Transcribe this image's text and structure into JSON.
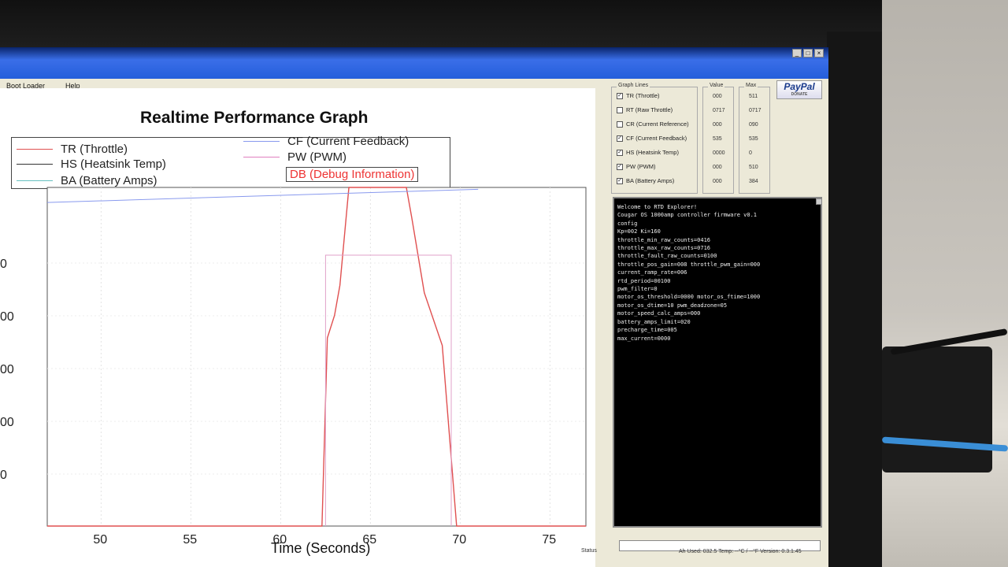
{
  "window": {
    "menu": [
      "Boot Loader",
      "Help"
    ],
    "controls": [
      "_",
      "□",
      "×"
    ]
  },
  "graph": {
    "title": "Realtime Performance Graph",
    "legend": [
      {
        "label": "TR (Throttle)",
        "color": "#e05050"
      },
      {
        "label": "HS (Heatsink Temp)",
        "color": "#333333"
      },
      {
        "label": "BA (Battery Amps)",
        "color": "#66c0c0"
      },
      {
        "label": "CF (Current Feedback)",
        "color": "#8899ee"
      },
      {
        "label": "PW (PWM)",
        "color": "#e080c0"
      },
      {
        "label": "DB (Debug Information)",
        "color": "#e05050",
        "highlighted": true
      }
    ],
    "xlabel": "Time (Seconds)",
    "x_ticks": [
      "50",
      "55",
      "60",
      "65",
      "70",
      "75"
    ],
    "y_ticks": [
      "0",
      "00",
      "00",
      "00",
      "0"
    ]
  },
  "chart_data": {
    "type": "line",
    "title": "Realtime Performance Graph",
    "xlabel": "Time (Seconds)",
    "ylabel": "",
    "xlim": [
      47,
      77
    ],
    "ylim": [
      0,
      900
    ],
    "series": [
      {
        "name": "TR (Throttle)",
        "x": [
          47,
          62.3,
          62.6,
          63,
          63.3,
          63.8,
          64,
          67,
          67.3,
          68,
          69,
          69.8,
          77
        ],
        "y": [
          0,
          0,
          500,
          560,
          640,
          900,
          900,
          900,
          820,
          620,
          480,
          0,
          0
        ]
      },
      {
        "name": "CF (Current Feedback)",
        "x": [
          47,
          71
        ],
        "y": [
          860,
          895
        ]
      },
      {
        "name": "PW (PWM)",
        "x": [
          62.5,
          62.5,
          69.5,
          69.5
        ],
        "y": [
          0,
          720,
          720,
          0
        ]
      }
    ]
  },
  "graph_lines": {
    "label": "Graph Lines",
    "value_header": "Value",
    "max_header": "Max",
    "items": [
      {
        "label": "TR (Throttle)",
        "checked": true,
        "value": "000",
        "max": "511"
      },
      {
        "label": "RT (Raw Throttle)",
        "checked": false,
        "value": "0717",
        "max": "0717"
      },
      {
        "label": "CR (Current Reference)",
        "checked": false,
        "value": "000",
        "max": "090"
      },
      {
        "label": "CF (Current Feedback)",
        "checked": true,
        "value": "535",
        "max": "535"
      },
      {
        "label": "HS (Heatsink Temp)",
        "checked": true,
        "value": "0000",
        "max": "0"
      },
      {
        "label": "PW (PWM)",
        "checked": true,
        "value": "000",
        "max": "510"
      },
      {
        "label": "BA (Battery Amps)",
        "checked": true,
        "value": "000",
        "max": "384"
      }
    ]
  },
  "paypal": {
    "brand": "PayPal",
    "sub": "DONATE"
  },
  "console": {
    "lines": [
      "Welcome to RTD Explorer!",
      "Cougar OS 1000amp controller firmware v0.1",
      "config",
      "Kp=002 Ki=160",
      "throttle_min_raw_counts=0416",
      "throttle_max_raw_counts=0716",
      "throttle_fault_raw_counts=0100",
      "throttle_pos_gain=008 throttle_pwm_gain=000",
      "current_ramp_rate=006",
      "rtd_period=00100",
      "pwm_filter=0",
      "motor_os_threshold=0000 motor_os_ftime=1000",
      "motor_os_dtime=10 pwm_deadzone=05",
      "motor_speed_calc_amps=000",
      "battery_amps_limit=020",
      "precharge_time=005",
      "max_current=0000"
    ]
  },
  "statusbar": {
    "status_label": "Status",
    "text": "Ah Used: 032.5  Temp: --°C / --°F  Version: 0.3.1.45"
  }
}
